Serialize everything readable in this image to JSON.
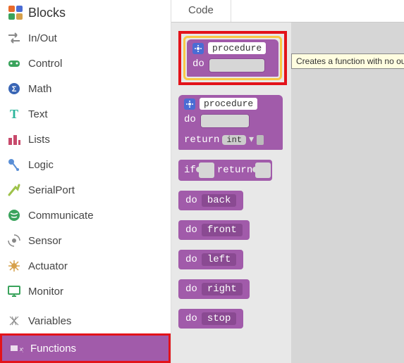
{
  "header": {
    "title": "Blocks"
  },
  "categories": [
    {
      "label": "In/Out",
      "icon": "inout-icon",
      "color": "#888"
    },
    {
      "label": "Control",
      "icon": "gamepad-icon",
      "color": "#3aa35c"
    },
    {
      "label": "Math",
      "icon": "math-icon",
      "color": "#3a66b5"
    },
    {
      "label": "Text",
      "icon": "text-icon",
      "color": "#2bb59b"
    },
    {
      "label": "Lists",
      "icon": "lists-icon",
      "color": "#c84a6c"
    },
    {
      "label": "Logic",
      "icon": "logic-icon",
      "color": "#5a8fd6"
    },
    {
      "label": "SerialPort",
      "icon": "serial-icon",
      "color": "#9ec24a"
    },
    {
      "label": "Communicate",
      "icon": "communicate-icon",
      "color": "#3aa35c"
    },
    {
      "label": "Sensor",
      "icon": "sensor-icon",
      "color": "#888"
    },
    {
      "label": "Actuator",
      "icon": "actuator-icon",
      "color": "#d6a04a"
    },
    {
      "label": "Monitor",
      "icon": "monitor-icon",
      "color": "#3aa35c"
    }
  ],
  "bottom": {
    "variables": "Variables",
    "functions": "Functions"
  },
  "tab": {
    "code": "Code"
  },
  "tooltip": "Creates a function with no output.",
  "proc1": {
    "name": "procedure",
    "do": "do"
  },
  "proc2": {
    "name": "procedure",
    "do": "do",
    "return": "return",
    "type": "int"
  },
  "if_block": {
    "if": "if",
    "return": "return"
  },
  "do_blocks": [
    {
      "do": "do",
      "name": "back"
    },
    {
      "do": "do",
      "name": "front"
    },
    {
      "do": "do",
      "name": "left"
    },
    {
      "do": "do",
      "name": "right"
    },
    {
      "do": "do",
      "name": "stop"
    }
  ]
}
